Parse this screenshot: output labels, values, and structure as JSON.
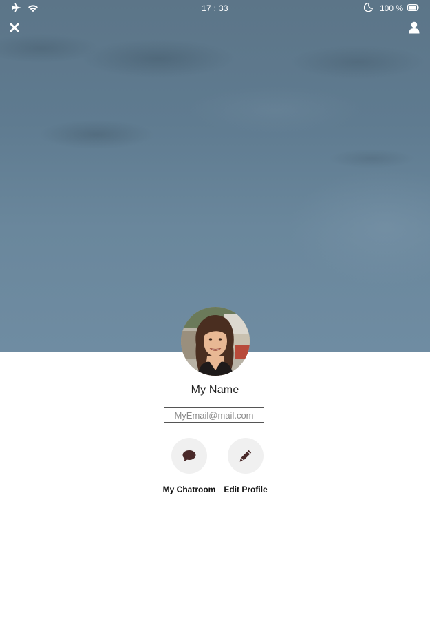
{
  "status_bar": {
    "time": "17 : 33",
    "battery": "100 %",
    "icons": [
      "airplane-icon",
      "wifi-icon",
      "moon-icon",
      "battery-icon"
    ]
  },
  "header": {
    "close_icon": "close-icon",
    "profile_icon": "user-icon"
  },
  "profile": {
    "name": "My Name",
    "email_placeholder": "MyEmail@mail.com",
    "email_value": ""
  },
  "actions": [
    {
      "label": "My Chatroom",
      "icon": "chat-bubble-icon"
    },
    {
      "label": "Edit Profile",
      "icon": "pencil-icon"
    }
  ],
  "colors": {
    "hero_sky": "#6a879c",
    "action_circle": "#f0f0f0",
    "action_icon": "#4a2a2a"
  }
}
